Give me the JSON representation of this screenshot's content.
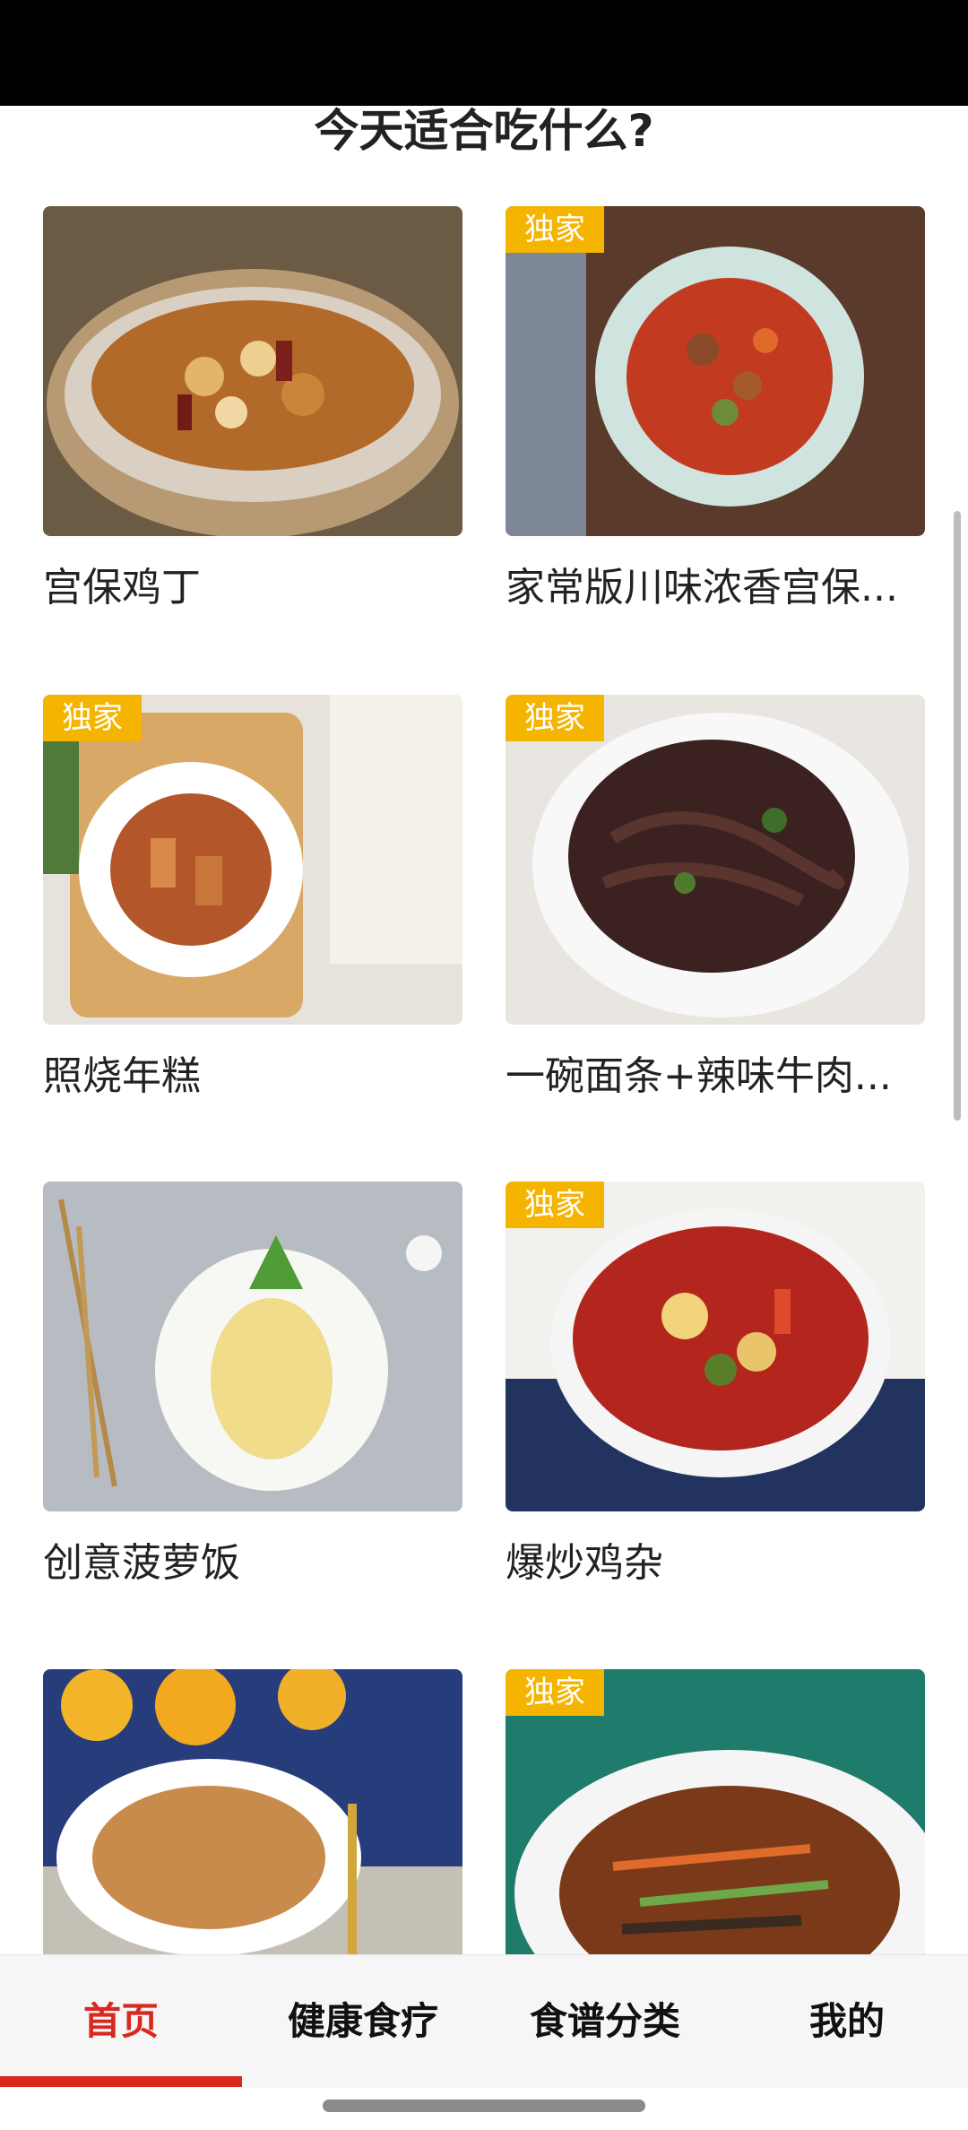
{
  "section": {
    "title": "今天适合吃什么?"
  },
  "recipes": [
    {
      "title": "宫保鸡丁",
      "badge": "",
      "image": "kung-pao-chicken-photo"
    },
    {
      "title": "家常版川味浓香宫保...",
      "badge": "独家",
      "image": "sichuan-kung-pao-photo"
    },
    {
      "title": "照烧年糕",
      "badge": "独家",
      "image": "teriyaki-rice-cake-photo"
    },
    {
      "title": "一碗面条+辣味牛肉...",
      "badge": "独家",
      "image": "spicy-beef-noodles-photo"
    },
    {
      "title": "创意菠萝饭",
      "badge": "",
      "image": "pineapple-rice-photo"
    },
    {
      "title": "爆炒鸡杂",
      "badge": "独家",
      "image": "stir-fried-giblets-photo"
    },
    {
      "title": "",
      "badge": "",
      "image": "fried-tofu-photo"
    },
    {
      "title": "",
      "badge": "独家",
      "image": "shredded-vegetables-photo"
    }
  ],
  "tabbar": {
    "tabs": [
      {
        "label": "首页",
        "active": true
      },
      {
        "label": "健康食疗",
        "active": false
      },
      {
        "label": "食谱分类",
        "active": false
      },
      {
        "label": "我的",
        "active": false
      }
    ]
  },
  "colors": {
    "accent": "#d9281e",
    "badge": "#f5b400"
  }
}
